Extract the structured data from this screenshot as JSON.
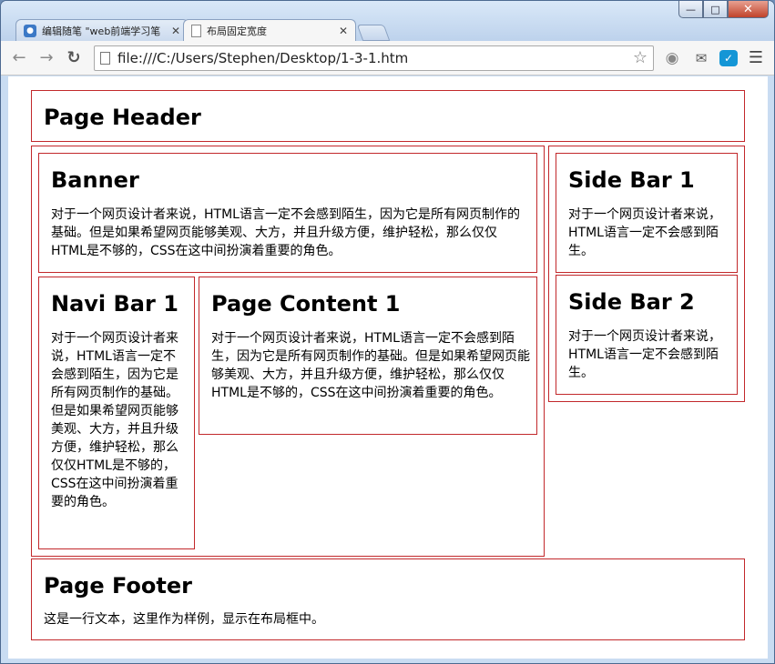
{
  "browser": {
    "tabs": [
      {
        "title": "编辑随笔 \"web前端学习笔",
        "icon": "blog-favicon"
      },
      {
        "title": "布局固定宽度",
        "icon": "page-favicon"
      }
    ],
    "url": "file:///C:/Users/Stephen/Desktop/1-3-1.htm"
  },
  "page": {
    "header": {
      "title": "Page Header"
    },
    "banner": {
      "title": "Banner",
      "text": "对于一个网页设计者来说，HTML语言一定不会感到陌生，因为它是所有网页制作的基础。但是如果希望网页能够美观、大方，并且升级方便，维护轻松，那么仅仅HTML是不够的，CSS在这中间扮演着重要的角色。"
    },
    "navi": {
      "title": "Navi Bar 1",
      "text": "对于一个网页设计者来说，HTML语言一定不会感到陌生，因为它是所有网页制作的基础。但是如果希望网页能够美观、大方，并且升级方便，维护轻松，那么仅仅HTML是不够的，CSS在这中间扮演着重要的角色。"
    },
    "content": {
      "title": "Page Content 1",
      "text": "对于一个网页设计者来说，HTML语言一定不会感到陌生，因为它是所有网页制作的基础。但是如果希望网页能够美观、大方，并且升级方便，维护轻松，那么仅仅HTML是不够的，CSS在这中间扮演着重要的角色。"
    },
    "side1": {
      "title": "Side Bar 1",
      "text": "对于一个网页设计者来说，HTML语言一定不会感到陌生。"
    },
    "side2": {
      "title": "Side Bar 2",
      "text": "对于一个网页设计者来说，HTML语言一定不会感到陌生。"
    },
    "footer": {
      "title": "Page Footer",
      "text": "这是一行文本，这里作为样例，显示在布局框中。"
    }
  },
  "colors": {
    "border": "#c2282b"
  }
}
